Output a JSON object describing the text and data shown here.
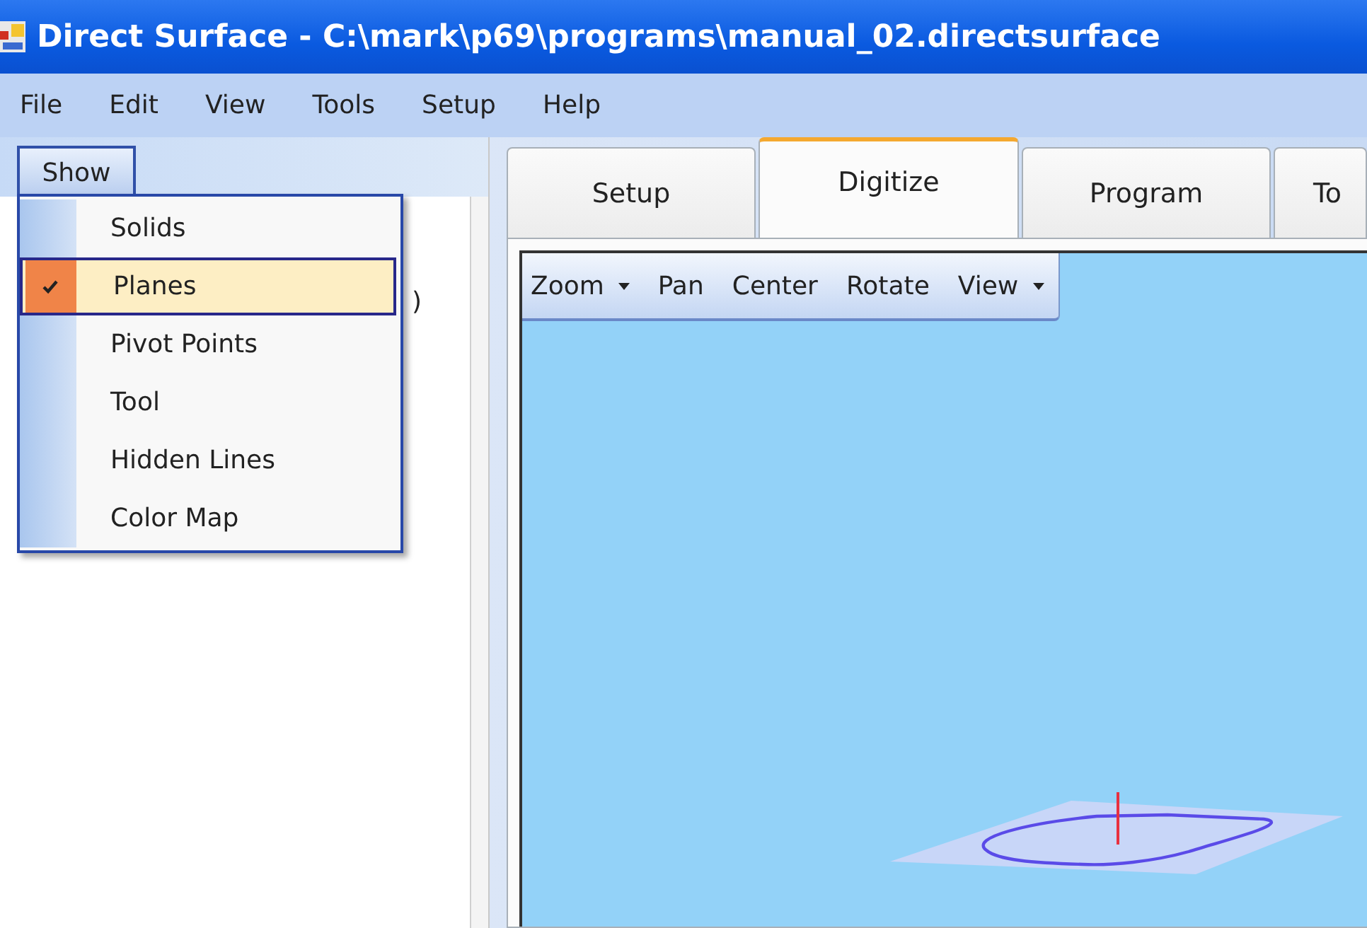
{
  "window": {
    "title": "Direct Surface - C:\\mark\\p69\\programs\\manual_02.directsurface"
  },
  "menu_bar": [
    "File",
    "Edit",
    "View",
    "Tools",
    "Setup",
    "Help"
  ],
  "show_menu": {
    "label": "Show",
    "items": [
      {
        "label": "Solids",
        "checked": false,
        "selected": false
      },
      {
        "label": "Planes",
        "checked": true,
        "selected": true
      },
      {
        "label": "Pivot Points",
        "checked": false,
        "selected": false
      },
      {
        "label": "Tool",
        "checked": false,
        "selected": false
      },
      {
        "label": "Hidden Lines",
        "checked": false,
        "selected": false
      },
      {
        "label": "Color Map",
        "checked": false,
        "selected": false
      }
    ]
  },
  "tree": {
    "items": [
      ")"
    ]
  },
  "tabs": [
    {
      "label": "Setup",
      "selected": false
    },
    {
      "label": "Digitize",
      "selected": true
    },
    {
      "label": "Program",
      "selected": false
    },
    {
      "label": "To",
      "selected": false
    }
  ],
  "view_toolbar": [
    {
      "label": "Zoom",
      "dropdown": true
    },
    {
      "label": "Pan",
      "dropdown": false
    },
    {
      "label": "Center",
      "dropdown": false
    },
    {
      "label": "Rotate",
      "dropdown": false
    },
    {
      "label": "View",
      "dropdown": true
    }
  ]
}
